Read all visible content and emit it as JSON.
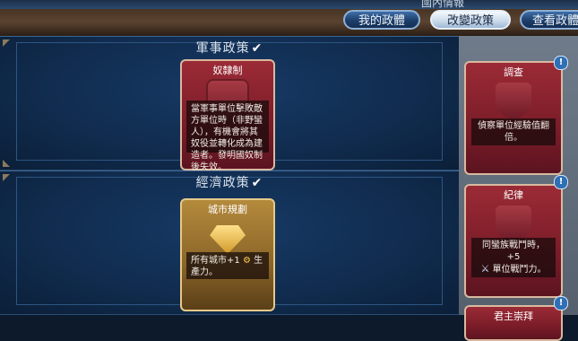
{
  "window": {
    "title": "國內情報"
  },
  "tabs": [
    {
      "label": "我的政體",
      "active": false
    },
    {
      "label": "改變政策",
      "active": true
    },
    {
      "label": "查看政體",
      "active": false
    }
  ],
  "sections": [
    {
      "title": "軍事政策",
      "policy": {
        "name": "奴隸制",
        "description": "當軍事單位擊敗敵方單位時（非野蠻人），有機會將其奴役並轉化成為建造者。發明國奴制後失效。"
      }
    },
    {
      "title": "經濟政策",
      "policy": {
        "name": "城市規劃",
        "description_prefix": "所有城市+1",
        "description_suffix": "生產力。"
      }
    }
  ],
  "side_cards": [
    {
      "name": "調查",
      "description": "偵察單位經驗值翻倍。"
    },
    {
      "name": "紀律",
      "description_line1": "同蠻族戰鬥時，+5",
      "description_line2": "單位戰鬥力。"
    },
    {
      "name": "君主崇拜"
    }
  ],
  "icons": {
    "check": "checkmark-icon",
    "info": "info-icon",
    "production": "production-icon",
    "combat": "sword-icon"
  },
  "colors": {
    "military_card": "#8b2432",
    "economic_card": "#9a7232",
    "active_tab": "#dfe8f2",
    "inactive_tab": "#1d3e6b"
  }
}
